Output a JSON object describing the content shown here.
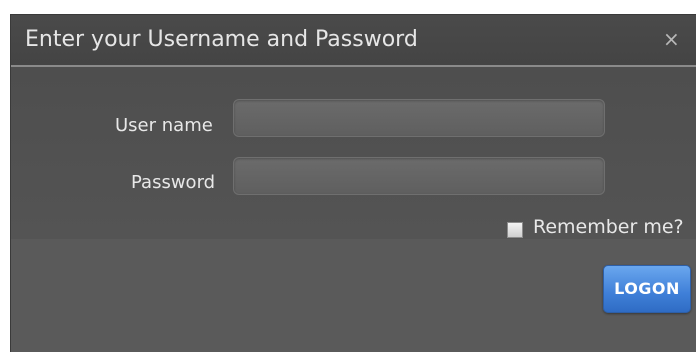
{
  "dialog": {
    "title": "Enter your Username and Password",
    "close_glyph": "×"
  },
  "form": {
    "username_label": "User name",
    "username_value": "",
    "password_label": "Password",
    "password_value": "",
    "remember_label": "Remember me?",
    "remember_checked": false,
    "logon_label": "LOGON"
  },
  "colors": {
    "accent": "#3f7fd8",
    "dialog_bg": "#595959"
  }
}
